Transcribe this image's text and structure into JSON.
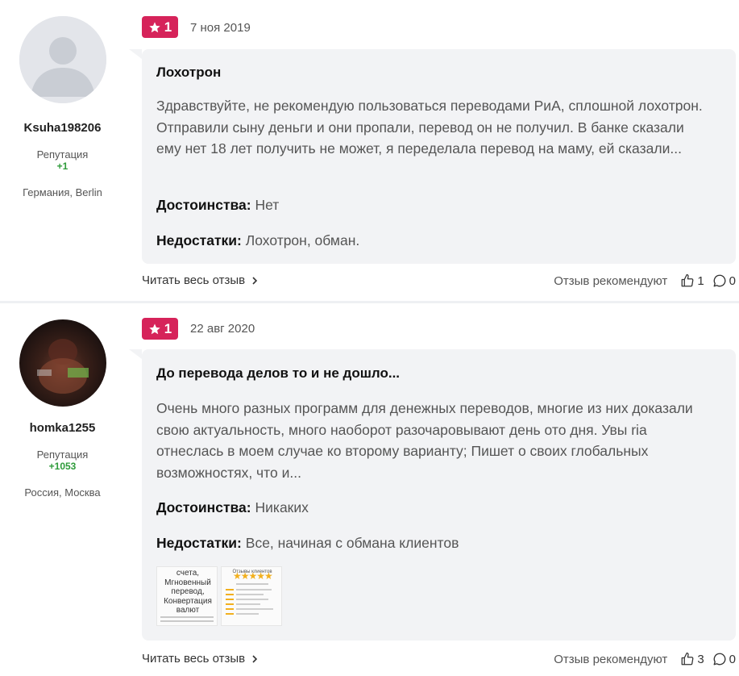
{
  "reviews": [
    {
      "author": {
        "username": "Ksuha198206",
        "reputation_label": "Репутация",
        "reputation_value": "+1",
        "location": "Германия, Berlin",
        "avatar": "avatar-placeholder"
      },
      "rating": "1",
      "date": "7 ноя 2019",
      "title": "Лохотрон",
      "text": "Здравствуйте, не рекомендую пользоваться переводами РиА, сплошной лохотрон. Отправили сыну деньги и они пропали, перевод он не получил. В банке сказали ему нет 18 лет получить не может, я переделала перевод на маму, ей сказали...",
      "pros_label": "Достоинства:",
      "pros": "Нет",
      "cons_label": "Недостатки:",
      "cons": "Лохотрон, обман.",
      "read_more": "Читать весь отзыв",
      "recommend_label": "Отзыв рекомендуют",
      "likes": "1",
      "comments": "0"
    },
    {
      "author": {
        "username": "homka1255",
        "reputation_label": "Репутация",
        "reputation_value": "+1053",
        "location": "Россия, Москва",
        "avatar": "avatar-photo"
      },
      "rating": "1",
      "date": "22 авг 2020",
      "title": "До перевода делов то и не дошло...",
      "text": "Очень много разных программ для денежных переводов, многие из них доказали свою актуальность, много наоборот разочаровывают день ото дня. Увы ria отнеслась в моем случае ко второму варианту; Пишет о своих глобальных возможностях, что и...",
      "pros_label": "Достоинства:",
      "pros": "Никаких",
      "cons_label": "Недостатки:",
      "cons": "Все, начиная с обмана клиентов",
      "thumbnails": [
        {
          "lines": [
            "счета,",
            "Мгновенный",
            "перевод,",
            "Конвертация",
            "валют"
          ]
        },
        {
          "title": "Отзывы клиентов",
          "stars": "★★★★★"
        }
      ],
      "read_more": "Читать весь отзыв",
      "recommend_label": "Отзыв рекомендуют",
      "likes": "3",
      "comments": "0"
    }
  ],
  "colors": {
    "badge": "#d6235a",
    "reputation": "#2e9b3a",
    "card_bg": "#f2f3f5"
  },
  "icons": [
    "star-icon",
    "chevron-right-icon",
    "thumbs-up-icon",
    "comment-icon"
  ]
}
